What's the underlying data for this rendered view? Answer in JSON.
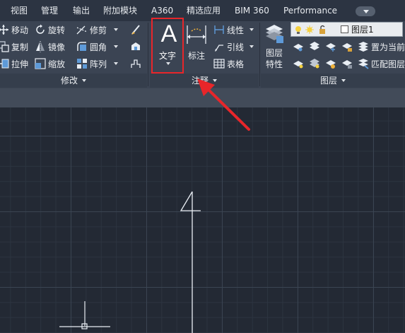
{
  "tabs": [
    {
      "label": "视图",
      "active": false
    },
    {
      "label": "管理",
      "active": false
    },
    {
      "label": "输出",
      "active": false
    },
    {
      "label": "附加模块",
      "active": false
    },
    {
      "label": "A360",
      "active": false
    },
    {
      "label": "精选应用",
      "active": false
    },
    {
      "label": "BIM 360",
      "active": false
    },
    {
      "label": "Performance",
      "active": false
    }
  ],
  "modify_panel": {
    "title": "修改",
    "buttons": [
      {
        "label": "移动",
        "icon": "move-icon"
      },
      {
        "label": "复制",
        "icon": "copy-icon"
      },
      {
        "label": "拉伸",
        "icon": "stretch-icon"
      },
      {
        "label": "旋转",
        "icon": "rotate-icon"
      },
      {
        "label": "镜像",
        "icon": "mirror-icon"
      },
      {
        "label": "缩放",
        "icon": "scale-icon"
      },
      {
        "label": "修剪",
        "icon": "trim-icon"
      },
      {
        "label": "圆角",
        "icon": "fillet-icon"
      },
      {
        "label": "阵列",
        "icon": "array-icon"
      }
    ]
  },
  "annotation_panel": {
    "title": "注释",
    "text_label": "文字",
    "text_glyph": "A",
    "dimension_label": "标注",
    "linear_label": "线性",
    "leader_label": "引线",
    "table_label": "表格"
  },
  "layers_panel": {
    "title": "图层",
    "properties_label_1": "图层",
    "properties_label_2": "特性",
    "current_layer": "图层1",
    "set_current_label": "置为当前",
    "match_layer_label": "匹配图层"
  },
  "colors": {
    "highlight": "#e8262a",
    "canvas_bg": "#232934",
    "ribbon_bg": "#3b4453"
  }
}
